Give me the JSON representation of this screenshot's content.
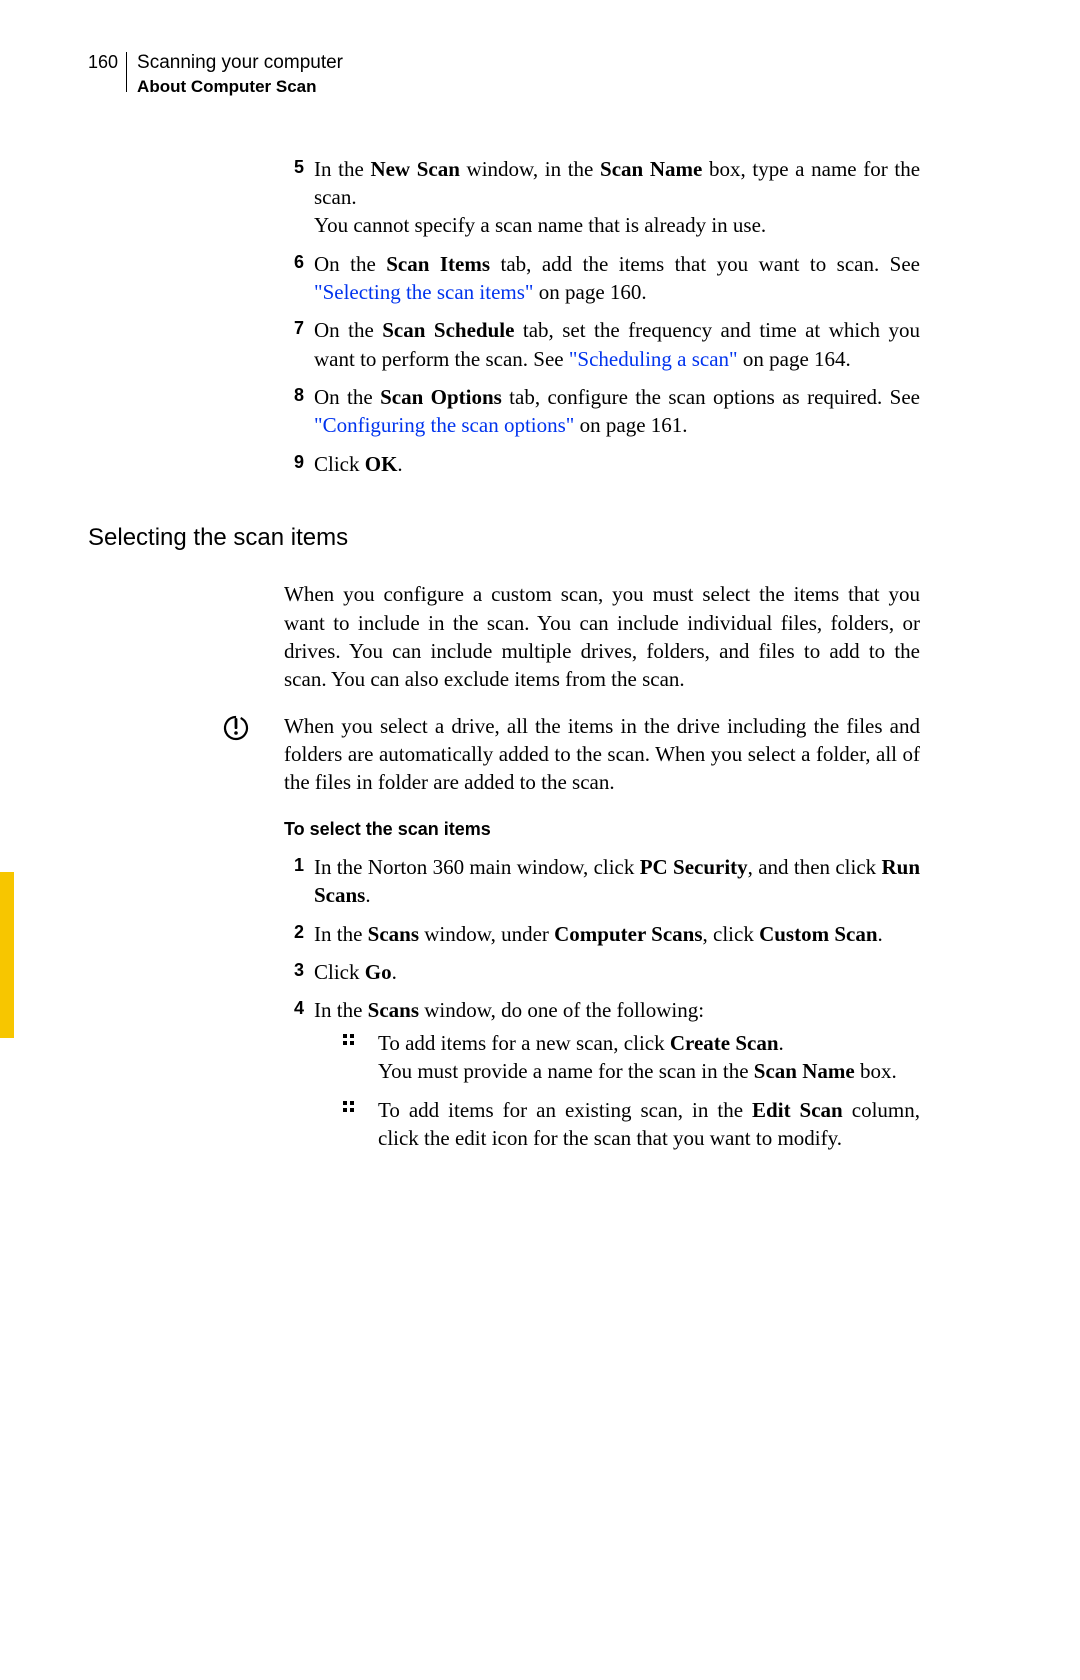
{
  "header": {
    "page_number": "160",
    "chapter": "Scanning your computer",
    "section": "About Computer Scan"
  },
  "steps_a": [
    {
      "num": "5",
      "parts": [
        {
          "t": "In the "
        },
        {
          "t": "New Scan",
          "b": true
        },
        {
          "t": " window, in the "
        },
        {
          "t": "Scan Name",
          "b": true
        },
        {
          "t": " box, type a name for the scan."
        }
      ],
      "parts2": [
        {
          "t": "You cannot specify a scan name that is already in use."
        }
      ]
    },
    {
      "num": "6",
      "parts": [
        {
          "t": "On the "
        },
        {
          "t": "Scan Items",
          "b": true
        },
        {
          "t": " tab, add the items that you want to scan. See "
        },
        {
          "t": "\"Selecting the scan items\"",
          "link": true
        },
        {
          "t": " on page 160."
        }
      ]
    },
    {
      "num": "7",
      "parts": [
        {
          "t": "On the "
        },
        {
          "t": "Scan Schedule",
          "b": true
        },
        {
          "t": " tab, set the frequency and time at which you want to perform the scan. See "
        },
        {
          "t": "\"Scheduling a scan\"",
          "link": true
        },
        {
          "t": " on page 164."
        }
      ]
    },
    {
      "num": "8",
      "parts": [
        {
          "t": "On the "
        },
        {
          "t": "Scan Options",
          "b": true
        },
        {
          "t": " tab, configure the scan options as required. See "
        },
        {
          "t": "\"Configuring the scan options\"",
          "link": true
        },
        {
          "t": " on page 161."
        }
      ]
    },
    {
      "num": "9",
      "parts": [
        {
          "t": "Click "
        },
        {
          "t": "OK",
          "b": true
        },
        {
          "t": "."
        }
      ]
    }
  ],
  "heading2": "Selecting the scan items",
  "intro_para": "When you configure a custom scan, you must select the items that you want to include in the scan. You can include individual files, folders, or drives. You can include multiple drives, folders, and files to add to the scan. You can also exclude items from the scan.",
  "note_para": "When you select a drive, all the items in the drive including the files and folders are automatically added to the scan. When you select a folder, all of the files in folder are added to the scan.",
  "substeps_title": "To select the scan items",
  "steps_b": [
    {
      "num": "1",
      "parts": [
        {
          "t": "In the Norton 360 main window, click "
        },
        {
          "t": "PC Security",
          "b": true
        },
        {
          "t": ", and then click "
        },
        {
          "t": "Run Scans",
          "b": true
        },
        {
          "t": "."
        }
      ]
    },
    {
      "num": "2",
      "parts": [
        {
          "t": "In the "
        },
        {
          "t": "Scans",
          "b": true
        },
        {
          "t": " window, under "
        },
        {
          "t": "Computer Scans",
          "b": true
        },
        {
          "t": ", click "
        },
        {
          "t": "Custom Scan",
          "b": true
        },
        {
          "t": "."
        }
      ]
    },
    {
      "num": "3",
      "parts": [
        {
          "t": "Click "
        },
        {
          "t": "Go",
          "b": true
        },
        {
          "t": "."
        }
      ]
    },
    {
      "num": "4",
      "parts": [
        {
          "t": "In the "
        },
        {
          "t": "Scans",
          "b": true
        },
        {
          "t": " window, do one of the following:"
        }
      ],
      "bullets": [
        {
          "parts": [
            {
              "t": "To add items for a new scan, click "
            },
            {
              "t": "Create Scan",
              "b": true
            },
            {
              "t": "."
            }
          ],
          "parts2": [
            {
              "t": "You must provide a name for the scan in the "
            },
            {
              "t": "Scan Name",
              "b": true
            },
            {
              "t": " box."
            }
          ]
        },
        {
          "parts": [
            {
              "t": "To add items for an existing scan, in the "
            },
            {
              "t": "Edit Scan",
              "b": true
            },
            {
              "t": " column, click the edit icon for the scan that you want to modify."
            }
          ]
        }
      ]
    }
  ],
  "icons": {
    "warning": "warning-icon",
    "bullet": "square-bullet-icon"
  }
}
